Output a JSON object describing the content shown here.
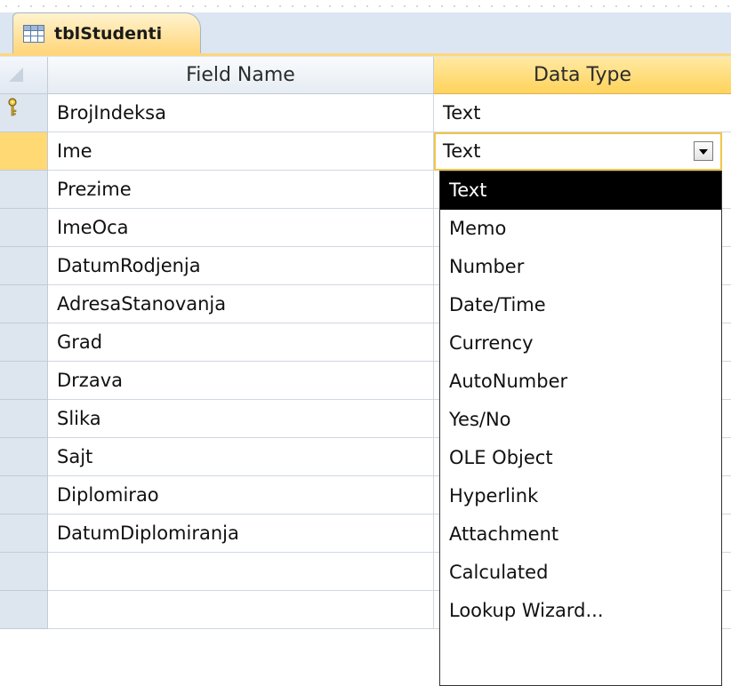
{
  "tab": {
    "label": "tblStudenti",
    "icon": "table-icon"
  },
  "headers": {
    "field_name": "Field Name",
    "data_type": "Data Type"
  },
  "rows": [
    {
      "name": "BrojIndeksa",
      "type": "Text",
      "primary_key": true
    },
    {
      "name": "Ime",
      "type": "Text",
      "current": true
    },
    {
      "name": "Prezime",
      "type": ""
    },
    {
      "name": "ImeOca",
      "type": ""
    },
    {
      "name": "DatumRodjenja",
      "type": ""
    },
    {
      "name": "AdresaStanovanja",
      "type": ""
    },
    {
      "name": "Grad",
      "type": ""
    },
    {
      "name": "Drzava",
      "type": ""
    },
    {
      "name": "Slika",
      "type": ""
    },
    {
      "name": "Sajt",
      "type": ""
    },
    {
      "name": "Diplomirao",
      "type": ""
    },
    {
      "name": "DatumDiplomiranja",
      "type": ""
    },
    {
      "name": "",
      "type": ""
    },
    {
      "name": "",
      "type": ""
    }
  ],
  "combo": {
    "value": "Text",
    "icon": "chevron-down-icon"
  },
  "dropdown": {
    "selected": "Text",
    "options": [
      "Text",
      "Memo",
      "Number",
      "Date/Time",
      "Currency",
      "AutoNumber",
      "Yes/No",
      "OLE Object",
      "Hyperlink",
      "Attachment",
      "Calculated",
      "Lookup Wizard..."
    ]
  },
  "colors": {
    "tab_gradient_top": "#fff3cf",
    "tab_gradient_bottom": "#ffd67a",
    "current_row_selector": "#ffd973",
    "selector_column": "#dde5ef",
    "dropdown_selected_bg": "#000000",
    "dropdown_selected_text": "#ffffff"
  }
}
